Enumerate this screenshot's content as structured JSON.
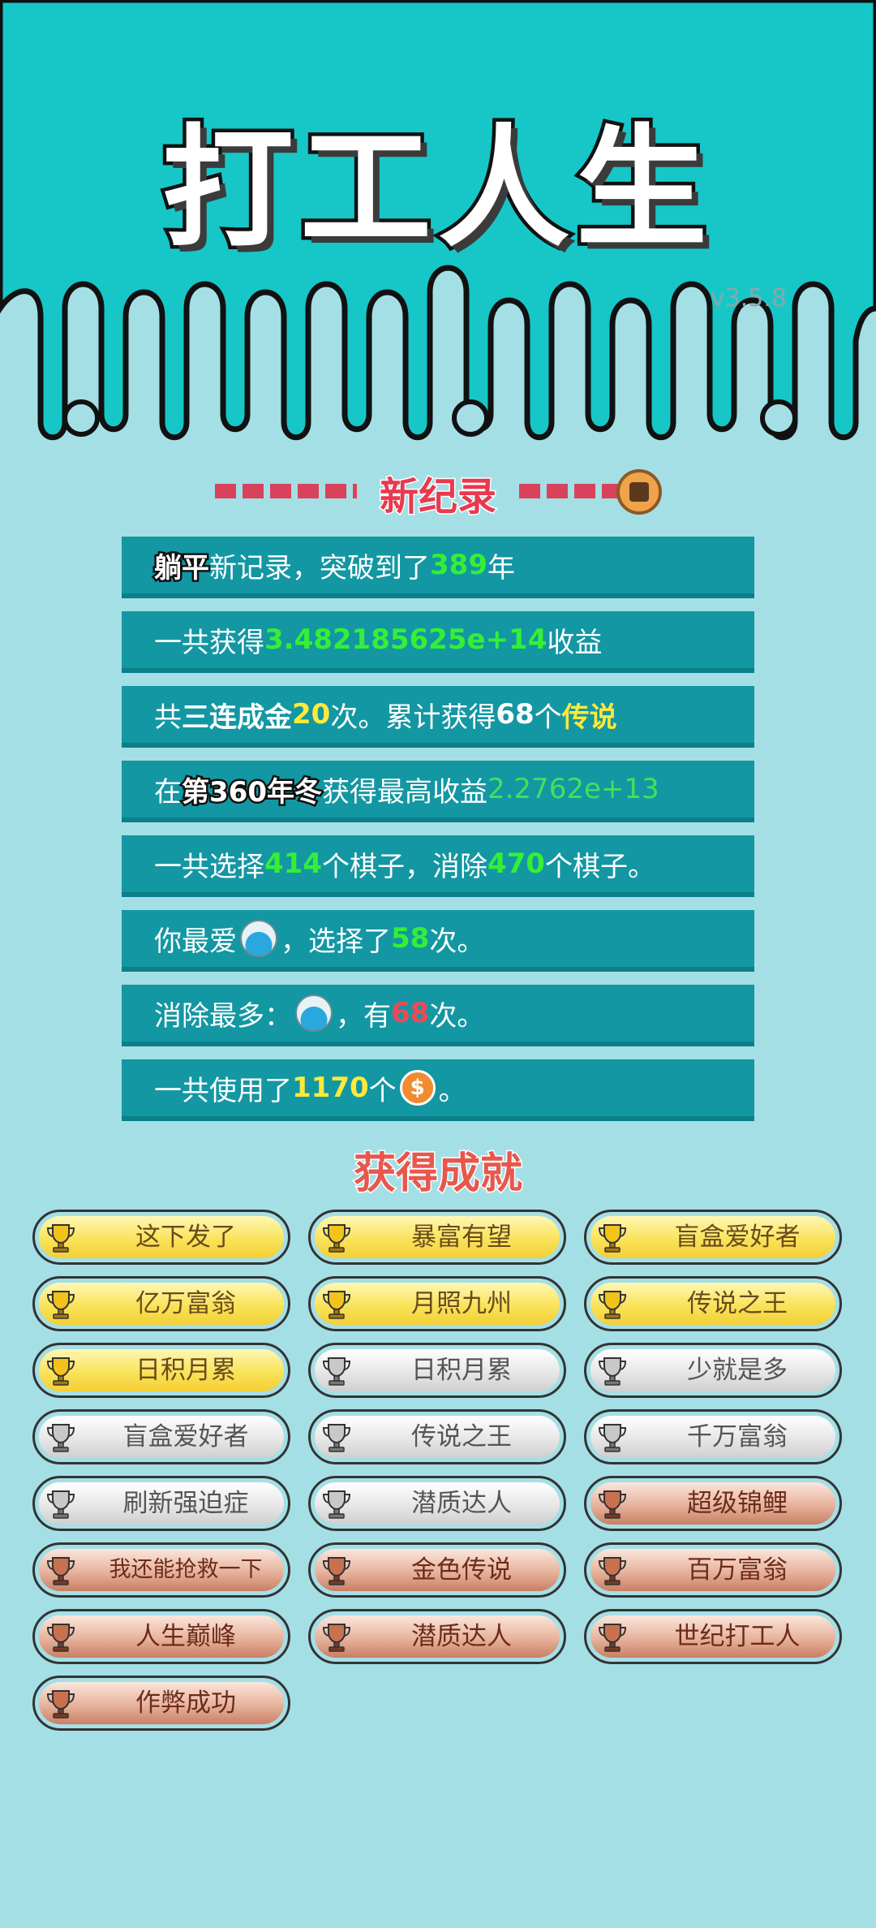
{
  "header": {
    "title": "打工人生",
    "version": "v3.5.8"
  },
  "record": {
    "title": "新纪录",
    "rows": [
      [
        {
          "t": "躺平",
          "c": "badge"
        },
        {
          "t": "新记录，突破到了"
        },
        {
          "t": "389",
          "c": "g"
        },
        {
          "t": "年"
        }
      ],
      [
        {
          "t": "一共获得"
        },
        {
          "t": "3.482185625e+14",
          "c": "g"
        },
        {
          "t": "收益"
        }
      ],
      [
        {
          "t": "共"
        },
        {
          "t": "三连成金",
          "c": "w"
        },
        {
          "t": "20",
          "c": "y"
        },
        {
          "t": "次。累计获得"
        },
        {
          "t": "68",
          "c": "w"
        },
        {
          "t": "个"
        },
        {
          "t": "传说",
          "c": "y"
        }
      ],
      [
        {
          "t": "在 "
        },
        {
          "t": "第360年冬",
          "c": "badge"
        },
        {
          "t": " 获得最高收益"
        },
        {
          "t": "2.2762e+13",
          "c": "g2"
        }
      ],
      [
        {
          "t": "一共选择"
        },
        {
          "t": "414",
          "c": "g"
        },
        {
          "t": "个棋子，消除"
        },
        {
          "t": "470",
          "c": "g"
        },
        {
          "t": "个棋子。"
        }
      ],
      [
        {
          "t": "你最爱"
        },
        {
          "icon": "ball-icon"
        },
        {
          "t": "，选择了"
        },
        {
          "t": "58",
          "c": "g"
        },
        {
          "t": "次。"
        }
      ],
      [
        {
          "t": "消除最多："
        },
        {
          "icon": "ball-icon"
        },
        {
          "t": "，有"
        },
        {
          "t": "68",
          "c": "r"
        },
        {
          "t": "次。"
        }
      ],
      [
        {
          "t": "一共使用了"
        },
        {
          "t": "1170",
          "c": "y"
        },
        {
          "t": "个"
        },
        {
          "icon": "coin-icon"
        },
        {
          "t": "。"
        }
      ]
    ]
  },
  "achievements": {
    "title": "获得成就",
    "items": [
      {
        "label": "这下发了",
        "tier": "gold"
      },
      {
        "label": "暴富有望",
        "tier": "gold"
      },
      {
        "label": "盲盒爱好者",
        "tier": "gold"
      },
      {
        "label": "亿万富翁",
        "tier": "gold"
      },
      {
        "label": "月照九州",
        "tier": "gold"
      },
      {
        "label": "传说之王",
        "tier": "gold"
      },
      {
        "label": "日积月累",
        "tier": "gold"
      },
      {
        "label": "日积月累",
        "tier": "silver"
      },
      {
        "label": "少就是多",
        "tier": "silver"
      },
      {
        "label": "盲盒爱好者",
        "tier": "silver"
      },
      {
        "label": "传说之王",
        "tier": "silver"
      },
      {
        "label": "千万富翁",
        "tier": "silver"
      },
      {
        "label": "刷新强迫症",
        "tier": "silver"
      },
      {
        "label": "潜质达人",
        "tier": "silver"
      },
      {
        "label": "超级锦鲤",
        "tier": "bronze"
      },
      {
        "label": "我还能抢救一下",
        "tier": "bronze"
      },
      {
        "label": "金色传说",
        "tier": "bronze"
      },
      {
        "label": "百万富翁",
        "tier": "bronze"
      },
      {
        "label": "人生巅峰",
        "tier": "bronze"
      },
      {
        "label": "潜质达人",
        "tier": "bronze"
      },
      {
        "label": "世纪打工人",
        "tier": "bronze"
      },
      {
        "label": "作弊成功",
        "tier": "bronze"
      }
    ]
  },
  "colors": {
    "header_teal": "#17c7c8",
    "stat_row": "#1397a3",
    "background": "#a5dfe6",
    "record_red": "#e8394f"
  }
}
